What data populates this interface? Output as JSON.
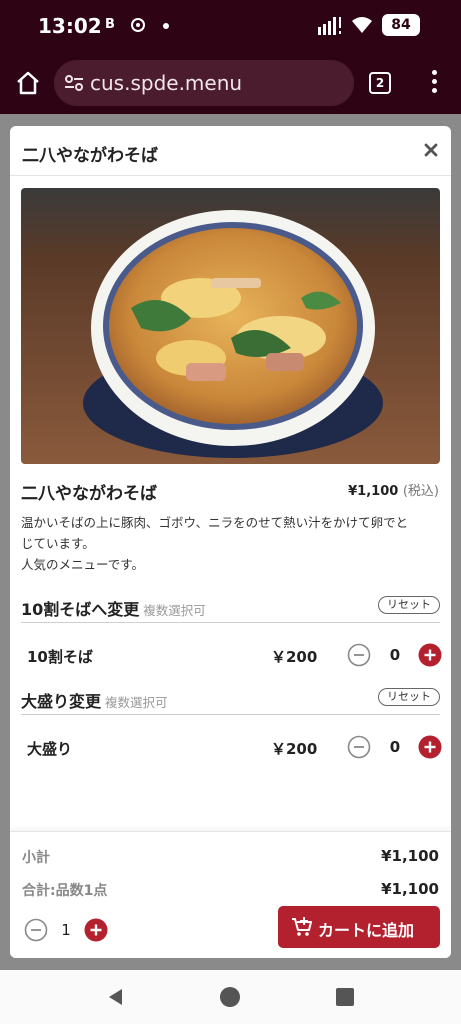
{
  "status_bar": {
    "time": "13:02",
    "notif_letter": "B",
    "battery": "84"
  },
  "browser": {
    "url": "cus.spde.menu",
    "tab_count": "2"
  },
  "modal": {
    "header_title": "二八やながわそば",
    "item_name": "二八やながわそば",
    "price": "¥1,100",
    "tax_label": "(税込)",
    "description": [
      "温かいそばの上に豚肉、ゴボウ、ニラをのせて熱い汁をかけて卵でと",
      "じています。",
      "人気のメニューです。"
    ]
  },
  "options": [
    {
      "group_title": "10割そばへ変更",
      "group_note": "複数選択可",
      "reset_label": "リセット",
      "item_name": "10割そば",
      "item_price": "￥200",
      "quantity": "0"
    },
    {
      "group_title": "大盛り変更",
      "group_note": "複数選択可",
      "reset_label": "リセット",
      "item_name": "大盛り",
      "item_price": "￥200",
      "quantity": "0"
    }
  ],
  "footer": {
    "subtotal_label": "小計",
    "subtotal_value": "¥1,100",
    "total_label": "合計:品数1点",
    "total_value": "¥1,100",
    "quantity": "1",
    "add_to_cart_label": "カートに追加"
  },
  "colors": {
    "browser_chrome": "#2e0415",
    "accent_red": "#b3202e"
  },
  "icons": [
    "home-icon",
    "site-settings-icon",
    "tabs-icon",
    "more-vert-icon",
    "close-icon",
    "minus-circle-icon",
    "plus-circle-icon",
    "cart-add-icon",
    "nav-back-icon",
    "nav-home-icon",
    "nav-recents-icon"
  ]
}
